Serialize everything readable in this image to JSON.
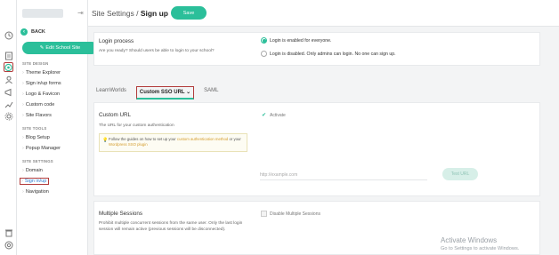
{
  "rail": {
    "icons": [
      "history-icon",
      "pages-icon",
      "design-icon",
      "users-icon",
      "marketing-icon",
      "reports-icon",
      "settings-icon",
      "trash-icon",
      "support-icon"
    ]
  },
  "sidebar": {
    "back_label": "BACK",
    "edit_button": "Edit School Site",
    "sections": [
      {
        "title": "SITE DESIGN",
        "items": [
          "Theme Explorer",
          "Sign in/up forms",
          "Logo & Favicon",
          "Custom code",
          "Site Flavors"
        ]
      },
      {
        "title": "SITE TOOLS",
        "items": [
          "Blog Setup",
          "Popup Manager"
        ]
      },
      {
        "title": "SITE SETTINGS",
        "items": [
          "Domain",
          "Sign in/up",
          "Navigation"
        ]
      }
    ],
    "active_item": "Sign in/up"
  },
  "topbar": {
    "breadcrumb_parent": "Site Settings / ",
    "breadcrumb_current": "Sign up",
    "save_label": "Save"
  },
  "login": {
    "title": "Login process",
    "desc": "Are you ready? Should users be able to login to your school?",
    "options": [
      {
        "label": "Login is enabled for everyone.",
        "selected": true
      },
      {
        "label": "Login is disabled. Only admins can login. No one can sign up.",
        "selected": false
      }
    ]
  },
  "tabs": [
    {
      "label": "LearnWorlds",
      "active": false
    },
    {
      "label": "Custom SSO URL",
      "active": true
    },
    {
      "label": "SAML",
      "active": false
    }
  ],
  "custom_url": {
    "title": "Custom URL",
    "desc": "The URL for your custom authentication",
    "hint_prefix": "Follow the guides on how to set up your ",
    "hint_link1": "custom authentication method",
    "hint_mid": " or your ",
    "hint_link2": "Wordpress SSO plugin",
    "activate_label": "Activate",
    "url_placeholder": "http://example.com",
    "test_button": "Test URL"
  },
  "multiple_sessions": {
    "title": "Multiple Sessions",
    "desc": "Prohibit multiple concurrent sessions from the same user. Only the last login session will remain active (previous sessions will be disconnected).",
    "checkbox_label": "Disable Multiple Sessions"
  },
  "watermark": {
    "line1": "Activate Windows",
    "line2": "Go to Settings to activate Windows."
  },
  "colors": {
    "accent": "#2bbf9a",
    "highlight": "#b23b3b",
    "link": "#2b7bd0"
  }
}
